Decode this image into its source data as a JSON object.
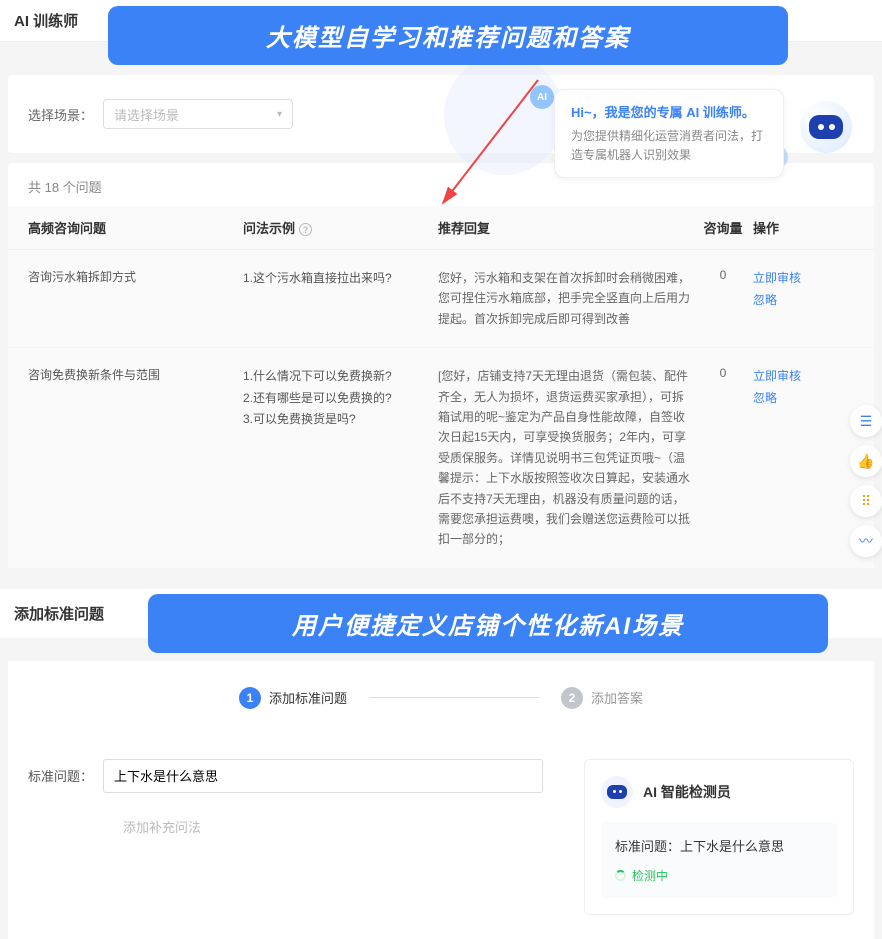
{
  "page_title": "AI 训练师",
  "banner1": "大模型自学习和推荐问题和答案",
  "scene": {
    "label": "选择场景：",
    "placeholder": "请选择场景"
  },
  "chat": {
    "greet": "Hi~，我是您的专属 AI 训练师。",
    "desc": "为您提供精细化运营消费者问法，打造专属机器人识别效果"
  },
  "count_text": "共 18 个问题",
  "headers": {
    "c1": "高频咨询问题",
    "c2": "问法示例",
    "c3": "推荐回复",
    "c4": "咨询量",
    "c5": "操作"
  },
  "rows": [
    {
      "q": "咨询污水箱拆卸方式",
      "ex": "1.这个污水箱直接拉出来吗?",
      "rec": "您好，污水箱和支架在首次拆卸时会稍微困难，您可捏住污水箱底部，把手完全竖直向上后用力提起。首次拆卸完成后即可得到改善",
      "cnt": "0",
      "op1": "立即审核",
      "op2": "忽略"
    },
    {
      "q": "咨询免费换新条件与范围",
      "ex": "1.什么情况下可以免费换新?\n2.还有哪些是可以免费换的?\n3.可以免费换货是吗?",
      "rec": "[您好，店铺支持7天无理由退货（需包装、配件齐全，无人为损坏，退货运费买家承担），可拆箱试用的呢~鉴定为产品自身性能故障，自签收次日起15天内，可享受换货服务；2年内，可享受质保服务。详情见说明书三包凭证页哦~（温馨提示：上下水版按照签收次日算起，安装通水后不支持7天无理由，机器没有质量问题的话，需要您承担运费噢，我们会赠送您运费险可以抵扣一部分的；",
      "cnt": "0",
      "op1": "立即审核",
      "op2": "忽略"
    }
  ],
  "section2_title": "添加标准问题",
  "banner2": "用户便捷定义店铺个性化新AI场景",
  "steps": {
    "s1": "添加标准问题",
    "s2": "添加答案"
  },
  "form": {
    "label": "标准问题：",
    "value": "上下水是什么意思",
    "supp_placeholder": "添加补充问法"
  },
  "detect": {
    "title": "AI 智能检测员",
    "q_label": "标准问题：",
    "q_value": "上下水是什么意思",
    "status": "检测中"
  }
}
